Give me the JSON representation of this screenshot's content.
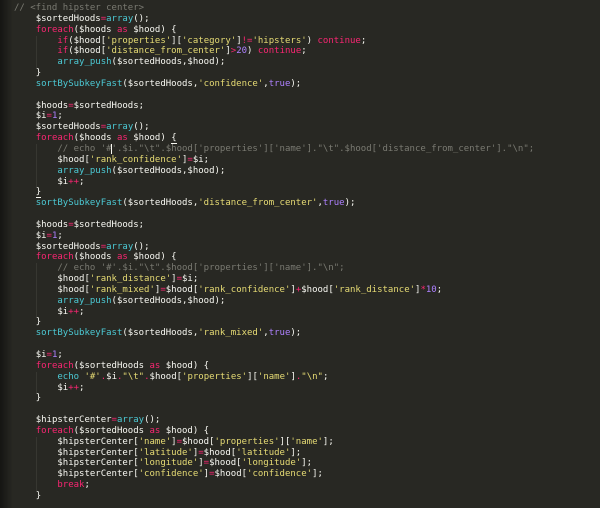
{
  "colors": {
    "background": "#282823",
    "plain": "#f8f8f2",
    "keyword": "#f92672",
    "string": "#e6db74",
    "function": "#4cc9d4",
    "constant": "#ae81ff",
    "comment": "#7a7a72",
    "caret": "#f8f8f0"
  },
  "code": {
    "language": "php",
    "lines": [
      {
        "tokens": [
          [
            "c",
            "// <find hipster center>"
          ]
        ]
      },
      {
        "tokens": [
          [
            "p",
            "\t$sortedHoods"
          ],
          [
            "k",
            "="
          ],
          [
            "f",
            "array"
          ],
          [
            "p",
            "();"
          ]
        ]
      },
      {
        "tokens": [
          [
            "p",
            "\t"
          ],
          [
            "k",
            "foreach"
          ],
          [
            "p",
            "($hoods "
          ],
          [
            "k",
            "as"
          ],
          [
            "p",
            " $hood) {"
          ]
        ]
      },
      {
        "tokens": [
          [
            "p",
            "\t\t"
          ],
          [
            "k",
            "if"
          ],
          [
            "p",
            "($hood["
          ],
          [
            "s",
            "'properties'"
          ],
          [
            "p",
            "]["
          ],
          [
            "s",
            "'category'"
          ],
          [
            "p",
            "]"
          ],
          [
            "k",
            "!="
          ],
          [
            "s",
            "'hipsters'"
          ],
          [
            "p",
            ") "
          ],
          [
            "k",
            "continue"
          ],
          [
            "p",
            ";"
          ]
        ]
      },
      {
        "tokens": [
          [
            "p",
            "\t\t"
          ],
          [
            "k",
            "if"
          ],
          [
            "p",
            "($hood["
          ],
          [
            "s",
            "'distance_from_center'"
          ],
          [
            "p",
            "]"
          ],
          [
            "k",
            ">"
          ],
          [
            "n",
            "20"
          ],
          [
            "p",
            ") "
          ],
          [
            "k",
            "continue"
          ],
          [
            "p",
            ";"
          ]
        ]
      },
      {
        "tokens": [
          [
            "p",
            "\t\t"
          ],
          [
            "f",
            "array_push"
          ],
          [
            "p",
            "($sortedHoods,$hood);"
          ]
        ]
      },
      {
        "tokens": [
          [
            "p",
            "\t}"
          ]
        ]
      },
      {
        "tokens": [
          [
            "p",
            "\t"
          ],
          [
            "f",
            "sortBySubkeyFast"
          ],
          [
            "p",
            "($sortedHoods,"
          ],
          [
            "s",
            "'confidence'"
          ],
          [
            "p",
            ","
          ],
          [
            "n",
            "true"
          ],
          [
            "p",
            ");"
          ]
        ]
      },
      {
        "tokens": []
      },
      {
        "tokens": [
          [
            "p",
            "\t$hoods"
          ],
          [
            "k",
            "="
          ],
          [
            "p",
            "$sortedHoods;"
          ]
        ]
      },
      {
        "tokens": [
          [
            "p",
            "\t$i"
          ],
          [
            "k",
            "="
          ],
          [
            "n",
            "1"
          ],
          [
            "p",
            ";"
          ]
        ]
      },
      {
        "tokens": [
          [
            "p",
            "\t$sortedHoods"
          ],
          [
            "k",
            "="
          ],
          [
            "f",
            "array"
          ],
          [
            "p",
            "();"
          ]
        ]
      },
      {
        "tokens": [
          [
            "p",
            "\t"
          ],
          [
            "k",
            "foreach"
          ],
          [
            "p",
            "($hoods "
          ],
          [
            "k",
            "as"
          ],
          [
            "p",
            " $hood) "
          ],
          [
            "pu",
            "{"
          ]
        ]
      },
      {
        "tokens": [
          [
            "p",
            "\t\t"
          ],
          [
            "c",
            "// echo '#"
          ],
          [
            "caret",
            ""
          ],
          [
            "c",
            "'.$i.\"\\t\".$hood['properties']['name'].\"\\t\".$hood['distance_from_center'].\"\\n\";"
          ]
        ]
      },
      {
        "tokens": [
          [
            "p",
            "\t\t$hood["
          ],
          [
            "s",
            "'rank_confidence'"
          ],
          [
            "p",
            "]"
          ],
          [
            "k",
            "="
          ],
          [
            "p",
            "$i;"
          ]
        ]
      },
      {
        "tokens": [
          [
            "p",
            "\t\t"
          ],
          [
            "f",
            "array_push"
          ],
          [
            "p",
            "($sortedHoods,$hood);"
          ]
        ]
      },
      {
        "tokens": [
          [
            "p",
            "\t\t$i"
          ],
          [
            "k",
            "++"
          ],
          [
            "p",
            ";"
          ]
        ]
      },
      {
        "tokens": [
          [
            "p",
            "\t"
          ],
          [
            "pu",
            "}"
          ]
        ]
      },
      {
        "tokens": [
          [
            "p",
            "\t"
          ],
          [
            "f",
            "sortBySubkeyFast"
          ],
          [
            "p",
            "($sortedHoods,"
          ],
          [
            "s",
            "'distance_from_center'"
          ],
          [
            "p",
            ","
          ],
          [
            "n",
            "true"
          ],
          [
            "p",
            ");"
          ]
        ]
      },
      {
        "tokens": []
      },
      {
        "tokens": [
          [
            "p",
            "\t$hoods"
          ],
          [
            "k",
            "="
          ],
          [
            "p",
            "$sortedHoods;"
          ]
        ]
      },
      {
        "tokens": [
          [
            "p",
            "\t$i"
          ],
          [
            "k",
            "="
          ],
          [
            "n",
            "1"
          ],
          [
            "p",
            ";"
          ]
        ]
      },
      {
        "tokens": [
          [
            "p",
            "\t$sortedHoods"
          ],
          [
            "k",
            "="
          ],
          [
            "f",
            "array"
          ],
          [
            "p",
            "();"
          ]
        ]
      },
      {
        "tokens": [
          [
            "p",
            "\t"
          ],
          [
            "k",
            "foreach"
          ],
          [
            "p",
            "($hoods "
          ],
          [
            "k",
            "as"
          ],
          [
            "p",
            " $hood) {"
          ]
        ]
      },
      {
        "tokens": [
          [
            "p",
            "\t\t"
          ],
          [
            "c",
            "// echo '#'.$i.\"\\t\".$hood['properties']['name'].\"\\n\";"
          ]
        ]
      },
      {
        "tokens": [
          [
            "p",
            "\t\t$hood["
          ],
          [
            "s",
            "'rank_distance'"
          ],
          [
            "p",
            "]"
          ],
          [
            "k",
            "="
          ],
          [
            "p",
            "$i;"
          ]
        ]
      },
      {
        "tokens": [
          [
            "p",
            "\t\t$hood["
          ],
          [
            "s",
            "'rank_mixed'"
          ],
          [
            "p",
            "]"
          ],
          [
            "k",
            "="
          ],
          [
            "p",
            "$hood["
          ],
          [
            "s",
            "'rank_confidence'"
          ],
          [
            "p",
            "]"
          ],
          [
            "k",
            "+"
          ],
          [
            "p",
            "$hood["
          ],
          [
            "s",
            "'rank_distance'"
          ],
          [
            "p",
            "]"
          ],
          [
            "k",
            "*"
          ],
          [
            "n",
            "10"
          ],
          [
            "p",
            ";"
          ]
        ]
      },
      {
        "tokens": [
          [
            "p",
            "\t\t"
          ],
          [
            "f",
            "array_push"
          ],
          [
            "p",
            "($sortedHoods,$hood);"
          ]
        ]
      },
      {
        "tokens": [
          [
            "p",
            "\t\t$i"
          ],
          [
            "k",
            "++"
          ],
          [
            "p",
            ";"
          ]
        ]
      },
      {
        "tokens": [
          [
            "p",
            "\t}"
          ]
        ]
      },
      {
        "tokens": [
          [
            "p",
            "\t"
          ],
          [
            "f",
            "sortBySubkeyFast"
          ],
          [
            "p",
            "($sortedHoods,"
          ],
          [
            "s",
            "'rank_mixed'"
          ],
          [
            "p",
            ","
          ],
          [
            "n",
            "true"
          ],
          [
            "p",
            ");"
          ]
        ]
      },
      {
        "tokens": []
      },
      {
        "tokens": [
          [
            "p",
            "\t$i"
          ],
          [
            "k",
            "="
          ],
          [
            "n",
            "1"
          ],
          [
            "p",
            ";"
          ]
        ]
      },
      {
        "tokens": [
          [
            "p",
            "\t"
          ],
          [
            "k",
            "foreach"
          ],
          [
            "p",
            "($sortedHoods "
          ],
          [
            "k",
            "as"
          ],
          [
            "p",
            " $hood) {"
          ]
        ]
      },
      {
        "tokens": [
          [
            "p",
            "\t\t"
          ],
          [
            "f",
            "echo"
          ],
          [
            "p",
            " "
          ],
          [
            "s",
            "'#'"
          ],
          [
            "k",
            "."
          ],
          [
            "p",
            "$i"
          ],
          [
            "k",
            "."
          ],
          [
            "s",
            "\"\\t\""
          ],
          [
            "k",
            "."
          ],
          [
            "p",
            "$hood["
          ],
          [
            "s",
            "'properties'"
          ],
          [
            "p",
            "]["
          ],
          [
            "s",
            "'name'"
          ],
          [
            "p",
            "]"
          ],
          [
            "k",
            "."
          ],
          [
            "s",
            "\"\\n\""
          ],
          [
            "p",
            ";"
          ]
        ]
      },
      {
        "tokens": [
          [
            "p",
            "\t\t$i"
          ],
          [
            "k",
            "++"
          ],
          [
            "p",
            ";"
          ]
        ]
      },
      {
        "tokens": [
          [
            "p",
            "\t}"
          ]
        ]
      },
      {
        "tokens": []
      },
      {
        "tokens": [
          [
            "p",
            "\t$hipsterCenter"
          ],
          [
            "k",
            "="
          ],
          [
            "f",
            "array"
          ],
          [
            "p",
            "();"
          ]
        ]
      },
      {
        "tokens": [
          [
            "p",
            "\t"
          ],
          [
            "k",
            "foreach"
          ],
          [
            "p",
            "($sortedHoods "
          ],
          [
            "k",
            "as"
          ],
          [
            "p",
            " $hood) {"
          ]
        ]
      },
      {
        "tokens": [
          [
            "p",
            "\t\t$hipsterCenter["
          ],
          [
            "s",
            "'name'"
          ],
          [
            "p",
            "]"
          ],
          [
            "k",
            "="
          ],
          [
            "p",
            "$hood["
          ],
          [
            "s",
            "'properties'"
          ],
          [
            "p",
            "]["
          ],
          [
            "s",
            "'name'"
          ],
          [
            "p",
            "];"
          ]
        ]
      },
      {
        "tokens": [
          [
            "p",
            "\t\t$hipsterCenter["
          ],
          [
            "s",
            "'latitude'"
          ],
          [
            "p",
            "]"
          ],
          [
            "k",
            "="
          ],
          [
            "p",
            "$hood["
          ],
          [
            "s",
            "'latitude'"
          ],
          [
            "p",
            "];"
          ]
        ]
      },
      {
        "tokens": [
          [
            "p",
            "\t\t$hipsterCenter["
          ],
          [
            "s",
            "'longitude'"
          ],
          [
            "p",
            "]"
          ],
          [
            "k",
            "="
          ],
          [
            "p",
            "$hood["
          ],
          [
            "s",
            "'longitude'"
          ],
          [
            "p",
            "];"
          ]
        ]
      },
      {
        "tokens": [
          [
            "p",
            "\t\t$hipsterCenter["
          ],
          [
            "s",
            "'confidence'"
          ],
          [
            "p",
            "]"
          ],
          [
            "k",
            "="
          ],
          [
            "p",
            "$hood["
          ],
          [
            "s",
            "'confidence'"
          ],
          [
            "p",
            "];"
          ]
        ]
      },
      {
        "tokens": [
          [
            "p",
            "\t\t"
          ],
          [
            "k",
            "break"
          ],
          [
            "p",
            ";"
          ]
        ]
      },
      {
        "tokens": [
          [
            "p",
            "\t}"
          ]
        ]
      }
    ]
  }
}
